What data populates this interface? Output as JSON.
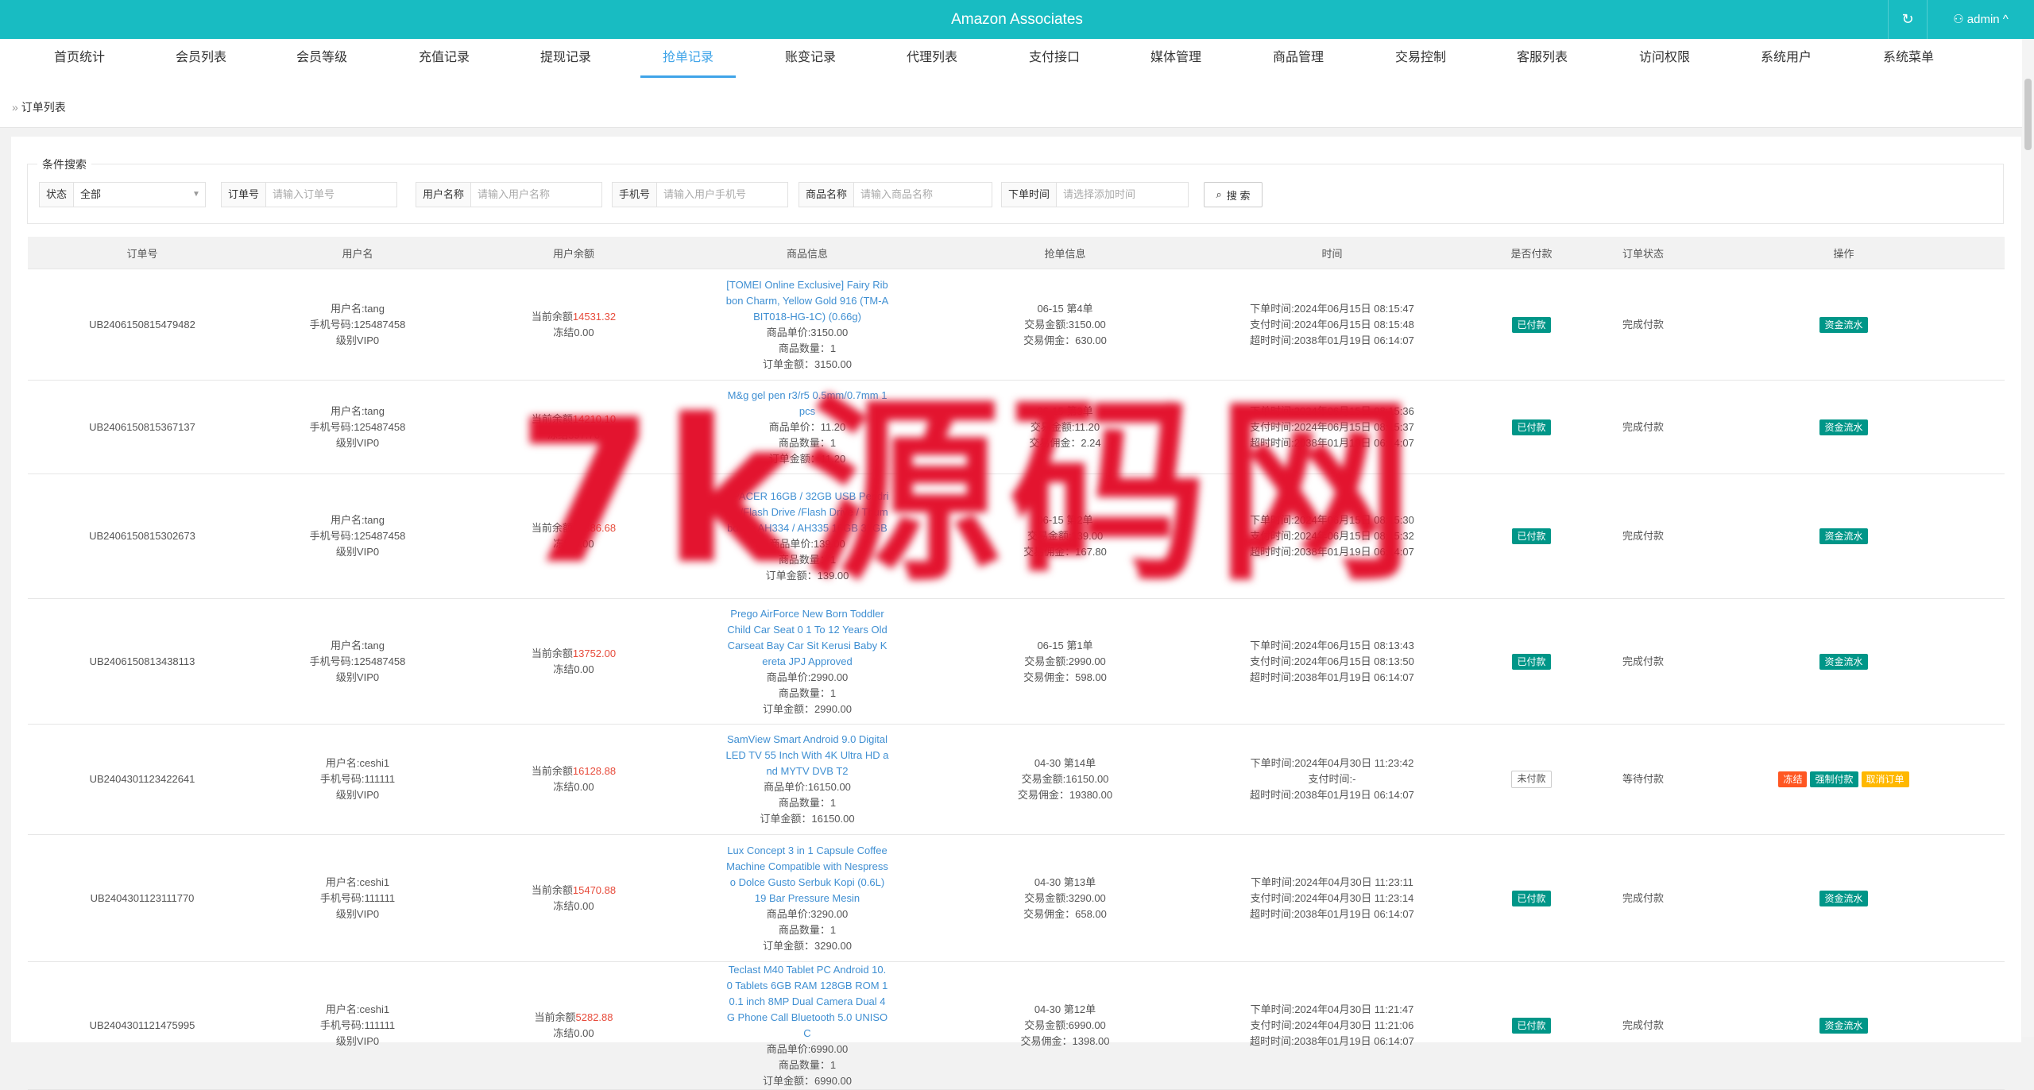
{
  "app": {
    "title": "Amazon Associates",
    "refresh_icon": "refresh-icon",
    "user_label": "admin"
  },
  "nav": [
    {
      "label": "首页统计"
    },
    {
      "label": "会员列表"
    },
    {
      "label": "会员等级"
    },
    {
      "label": "充值记录"
    },
    {
      "label": "提现记录"
    },
    {
      "label": "抢单记录",
      "active": true
    },
    {
      "label": "账变记录"
    },
    {
      "label": "代理列表"
    },
    {
      "label": "支付接口"
    },
    {
      "label": "媒体管理"
    },
    {
      "label": "商品管理"
    },
    {
      "label": "交易控制"
    },
    {
      "label": "客服列表"
    },
    {
      "label": "访问权限"
    },
    {
      "label": "系统用户"
    },
    {
      "label": "系统菜单"
    }
  ],
  "breadcrumb": {
    "sep": "»",
    "label": "订单列表"
  },
  "search": {
    "legend": "条件搜索",
    "status_label": "状态",
    "status_value": "全部",
    "order_label": "订单号",
    "order_placeholder": "请输入订单号",
    "username_label": "用户名称",
    "username_placeholder": "请输入用户名称",
    "phone_label": "手机号",
    "phone_placeholder": "请输入用户手机号",
    "goods_label": "商品名称",
    "goods_placeholder": "请输入商品名称",
    "time_label": "下单时间",
    "time_placeholder": "请选择添加时间",
    "button": "搜 索"
  },
  "table": {
    "headers": [
      "订单号",
      "用户名",
      "用户余额",
      "商品信息",
      "抢单信息",
      "时间",
      "是否付款",
      "订单状态",
      "操作"
    ],
    "rows": [
      {
        "order": "UB2406150815479482",
        "user": [
          "用户名:tang",
          "手机号码:125487458",
          "级别VIP0"
        ],
        "bal_prefix": "当前余额",
        "bal": "14531.32",
        "frozen": "冻结0.00",
        "goods": "[TOMEI Online Exclusive] Fairy Ribbon Charm, Yellow Gold 916 (TM-ABIT018-HG-1C) (0.66g)",
        "price": "商品单价:3150.00",
        "qty": "商品数量：1",
        "total": "订单金额：3150.00",
        "grab": [
          "06-15 第4单",
          "交易金额:3150.00",
          "交易佣金：630.00"
        ],
        "time": [
          "下单时间:2024年06月15日 08:15:47",
          "支付时间:2024年06月15日 08:15:48",
          "超时时间:2038年01月19日 06:14:07"
        ],
        "paid": "已付款",
        "state": "完成付款",
        "ops": [
          "资金流水"
        ]
      },
      {
        "order": "UB2406150815367137",
        "user": [
          "用户名:tang",
          "手机号码:125487458",
          "级别VIP0"
        ],
        "bal_prefix": "当前余额",
        "bal": "14210.10",
        "frozen": "冻结397.76",
        "goods": "M&g gel pen r3/r5 0.5mm/0.7mm 1pcs",
        "price": "商品单价：11.20",
        "qty": "商品数量：1",
        "total": "订单金额：11.20",
        "grab": [
          "06-15 第3单",
          "交易金额:11.20",
          "交易佣金：2.24"
        ],
        "time": [
          "下单时间:2024年06月15日 08:15:36",
          "支付时间:2024年06月15日 08:15:37",
          "超时时间:2038年01月19日 06:14:07"
        ],
        "paid": "已付款",
        "state": "完成付款",
        "ops": [
          "资金流水"
        ]
      },
      {
        "order": "UB2406150815302673",
        "user": [
          "用户名:tang",
          "手机号码:125487458",
          "级别VIP0"
        ],
        "bal_prefix": "当前余额",
        "bal": "14386.68",
        "frozen": "冻结0.00",
        "goods": "APACER 16GB / 32GB USB Pendrive /Flash Drive /Flash Drive / Thumbdrive AH334 / AH335 16GB 32GB",
        "price": "商品单价:139.00",
        "qty": "商品数量：1",
        "total": "订单金额：139.00",
        "grab": [
          "06-15 第2单",
          "交易金额:139.00",
          "交易佣金：167.80"
        ],
        "time": [
          "下单时间:2024年06月15日 08:15:30",
          "支付时间:2024年06月15日 08:15:32",
          "超时时间:2038年01月19日 06:14:07"
        ],
        "paid": "已付款",
        "state": "完成付款",
        "ops": [
          "资金流水"
        ]
      },
      {
        "order": "UB2406150813438113",
        "user": [
          "用户名:tang",
          "手机号码:125487458",
          "级别VIP0"
        ],
        "bal_prefix": "当前余额",
        "bal": "13752.00",
        "frozen": "冻结0.00",
        "goods": "Prego AirForce New Born Toddler Child Car Seat 0 1 To 12 Years Old Carseat Bay Car Sit Kerusi Baby Kereta JPJ Approved",
        "price": "商品单价:2990.00",
        "qty": "商品数量：1",
        "total": "订单金额：2990.00",
        "grab": [
          "06-15 第1单",
          "交易金额:2990.00",
          "交易佣金：598.00"
        ],
        "time": [
          "下单时间:2024年06月15日 08:13:43",
          "支付时间:2024年06月15日 08:13:50",
          "超时时间:2038年01月19日 06:14:07"
        ],
        "paid": "已付款",
        "state": "完成付款",
        "ops": [
          "资金流水"
        ]
      },
      {
        "order": "UB2404301123422641",
        "user": [
          "用户名:ceshi1",
          "手机号码:111111",
          "级别VIP0"
        ],
        "bal_prefix": "当前余额",
        "bal": "16128.88",
        "frozen": "冻结0.00",
        "goods": "SamView Smart Android 9.0 Digital LED TV 55 Inch With 4K Ultra HD and MYTV DVB T2",
        "price": "商品单价:16150.00",
        "qty": "商品数量：1",
        "total": "订单金额：16150.00",
        "grab": [
          "04-30 第14单",
          "交易金额:16150.00",
          "交易佣金：19380.00"
        ],
        "time": [
          "下单时间:2024年04月30日 11:23:42",
          "支付时间:-",
          "超时时间:2038年01月19日 06:14:07"
        ],
        "paid": "未付款",
        "state": "等待付款",
        "ops": [
          "冻结",
          "强制付款",
          "取消订单"
        ]
      },
      {
        "order": "UB2404301123111770",
        "user": [
          "用户名:ceshi1",
          "手机号码:111111",
          "级别VIP0"
        ],
        "bal_prefix": "当前余额",
        "bal": "15470.88",
        "frozen": "冻结0.00",
        "goods": "Lux Concept 3 in 1 Capsule Coffee Machine Compatible with Nespresso Dolce Gusto Serbuk Kopi (0.6L) 19 Bar Pressure Mesin",
        "price": "商品单价:3290.00",
        "qty": "商品数量：1",
        "total": "订单金额：3290.00",
        "grab": [
          "04-30 第13单",
          "交易金额:3290.00",
          "交易佣金：658.00"
        ],
        "time": [
          "下单时间:2024年04月30日 11:23:11",
          "支付时间:2024年04月30日 11:23:14",
          "超时时间:2038年01月19日 06:14:07"
        ],
        "paid": "已付款",
        "state": "完成付款",
        "ops": [
          "资金流水"
        ]
      },
      {
        "order": "UB2404301121475995",
        "user": [
          "用户名:ceshi1",
          "手机号码:111111",
          "级别VIP0"
        ],
        "bal_prefix": "当前余额",
        "bal": "5282.88",
        "frozen": "冻结0.00",
        "goods": "Teclast M40 Tablet PC Android 10.0 Tablets 6GB RAM 128GB ROM 10.1 inch 8MP Dual Camera Dual 4G Phone Call Bluetooth 5.0 UNISOC",
        "price": "商品单价:6990.00",
        "qty": "商品数量：1",
        "total": "订单金额：6990.00",
        "grab": [
          "04-30 第12单",
          "交易金额:6990.00",
          "交易佣金：1398.00"
        ],
        "time": [
          "下单时间:2024年04月30日 11:21:47",
          "支付时间:2024年04月30日 11:21:06",
          "超时时间:2038年01月19日 06:14:07"
        ],
        "paid": "已付款",
        "state": "完成付款",
        "ops": [
          "资金流水"
        ]
      }
    ]
  },
  "watermark": "7k源码网"
}
